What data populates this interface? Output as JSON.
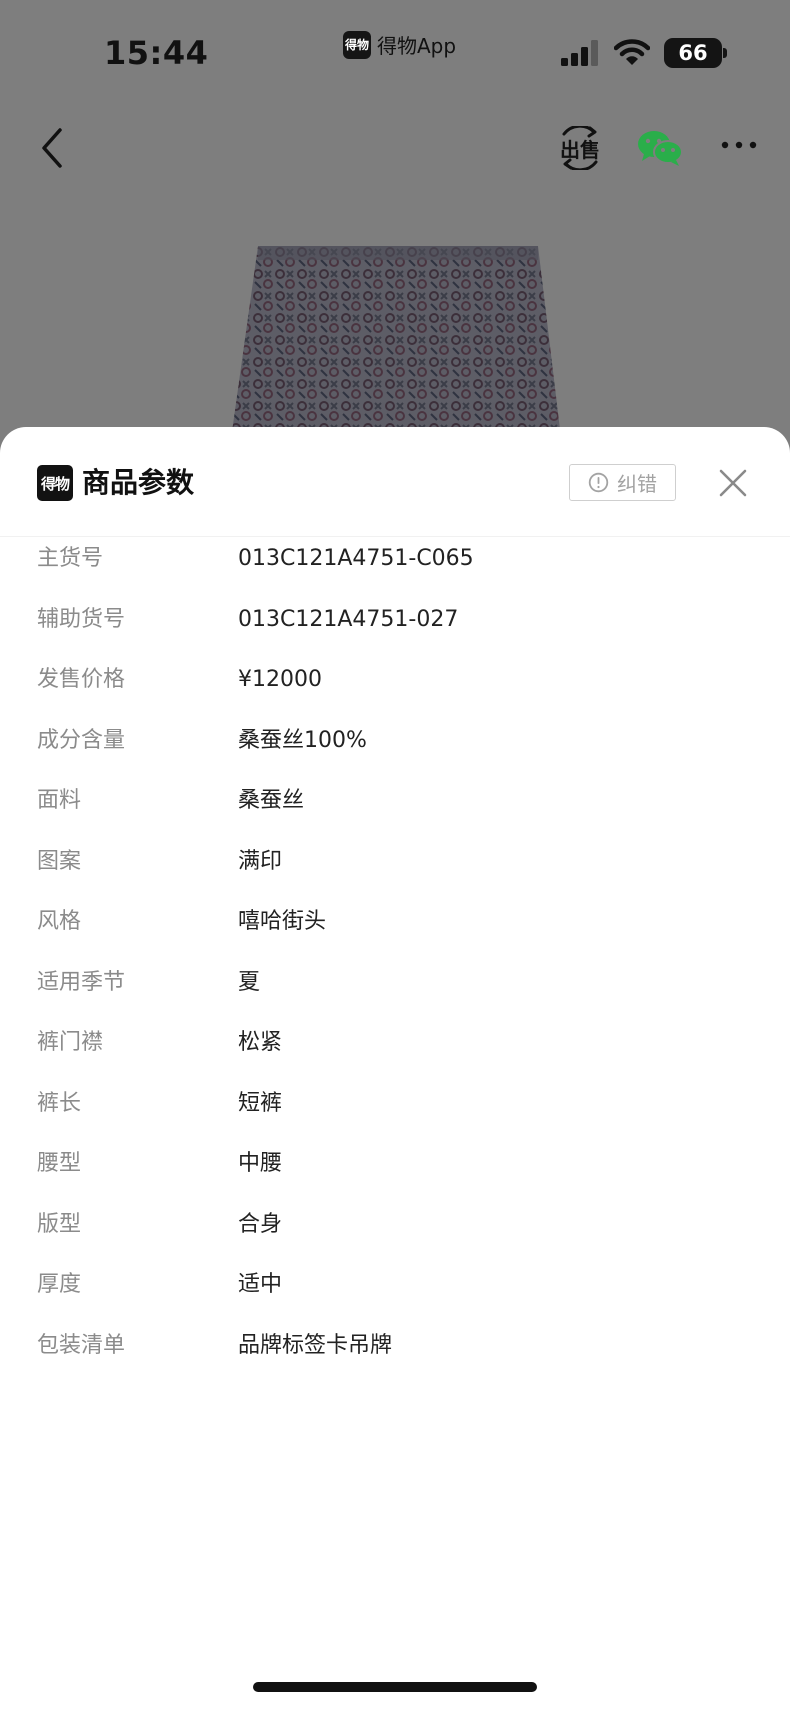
{
  "status_bar": {
    "time": "15:44",
    "app_logo_text": "得物",
    "app_name": "得物App",
    "battery": "66"
  },
  "nav": {
    "sell_label": "出售",
    "icons": [
      "back-arrow-icon",
      "sell-icon",
      "wechat-icon",
      "more-icon"
    ]
  },
  "sheet": {
    "logo_text": "得物",
    "title": "商品参数",
    "report_label": "纠错",
    "params": [
      {
        "label": "主货号",
        "value": "013C121A4751-C065"
      },
      {
        "label": "辅助货号",
        "value": "013C121A4751-027"
      },
      {
        "label": "发售价格",
        "value": "¥12000"
      },
      {
        "label": "成分含量",
        "value": "桑蚕丝100%"
      },
      {
        "label": "面料",
        "value": "桑蚕丝"
      },
      {
        "label": "图案",
        "value": "满印"
      },
      {
        "label": "风格",
        "value": "嘻哈街头"
      },
      {
        "label": "适用季节",
        "value": "夏"
      },
      {
        "label": "裤门襟",
        "value": "松紧"
      },
      {
        "label": "裤长",
        "value": "短裤"
      },
      {
        "label": "腰型",
        "value": "中腰"
      },
      {
        "label": "版型",
        "value": "合身"
      },
      {
        "label": "厚度",
        "value": "适中"
      },
      {
        "label": "包装清单",
        "value": "品牌标签卡吊牌"
      }
    ]
  },
  "colors": {
    "overlay": "#7e7e7e",
    "label": "#8b8b8b",
    "value": "#222222",
    "wechat_green": "#2aae4a"
  }
}
